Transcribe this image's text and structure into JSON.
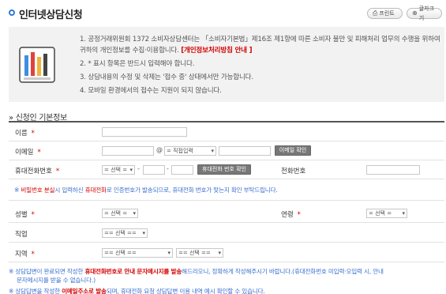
{
  "header": {
    "title": "인터넷상담신청",
    "print_label": "프린트",
    "size_label": "글자크기"
  },
  "info": {
    "items": [
      {
        "num": "1.",
        "text": "공정거래위원회 1372 소비자상담센터는 「소비자기본법」제16조 제1항에 따른 소비자 불만 및 피해처리 업무의 수행을 위하여 귀하의 개인정보를 수집·이용합니다.",
        "link": "[개인정보처리방침 안내 ]"
      },
      {
        "num": "2.",
        "text": "* 표시 항목은 반드시 입력해야 합니다."
      },
      {
        "num": "3.",
        "text": "상담내용의 수정 및 삭제는 '접수 중' 상태에서만 가능합니다."
      },
      {
        "num": "4.",
        "text": "모바일 환경에서의 접수는 지원이 되지 않습니다."
      }
    ]
  },
  "section": {
    "title": "» 신청인 기본정보"
  },
  "form": {
    "required_mark": "*",
    "name_label": "이름",
    "email_label": "이메일",
    "email_at": "@",
    "email_domain_select": "직접입력",
    "email_check_button": "이메일 확인",
    "mobile_label": "휴대전화번호",
    "mobile_select": "= 선택 =",
    "dash": "-",
    "mobile_check_button": "휴대전화 번호 확인",
    "phone_label": "전화번호",
    "notice_prefix": "※",
    "notice_red1": "비밀번호 분실",
    "notice_mid": "시 입력하신",
    "notice_red2": "휴대전화",
    "notice_rest": "로 인증번호가 발송되므로, 휴대전화 번호가 맞는지 확인 부탁드립니다.",
    "gender_label": "성별",
    "gender_select": "= 선택 =",
    "age_label": "연령",
    "age_select": "= 선택 =",
    "job_label": "직업",
    "job_select": "== 선택 ==",
    "region_label": "지역",
    "region_select1": "== 선택 ==",
    "region_select2": "== 선택 =="
  },
  "footer": {
    "line1_prefix": "※ 상담답변이 완료되면 작성한",
    "line1_red": "휴대전화번호로 안내 문자메시지를 발송",
    "line1_rest": "해드리오니, 정확하게 작성해주시기 바랍니다.(휴대전화번호 미입력·오입력 시, 안내",
    "line2": "문자메시지를 받을 수 없습니다.)",
    "line3_prefix": "※ 상담답변을 작성한",
    "line3_red": "이메일주소로 발송",
    "line3_rest": "되며, 휴대전화 요청 상담답변 이용 내역 예시 확인할 수 있습니다."
  },
  "colors": {
    "accent": "#2b7bd6",
    "required": "#d30000",
    "notice": "#3a6fd0"
  }
}
